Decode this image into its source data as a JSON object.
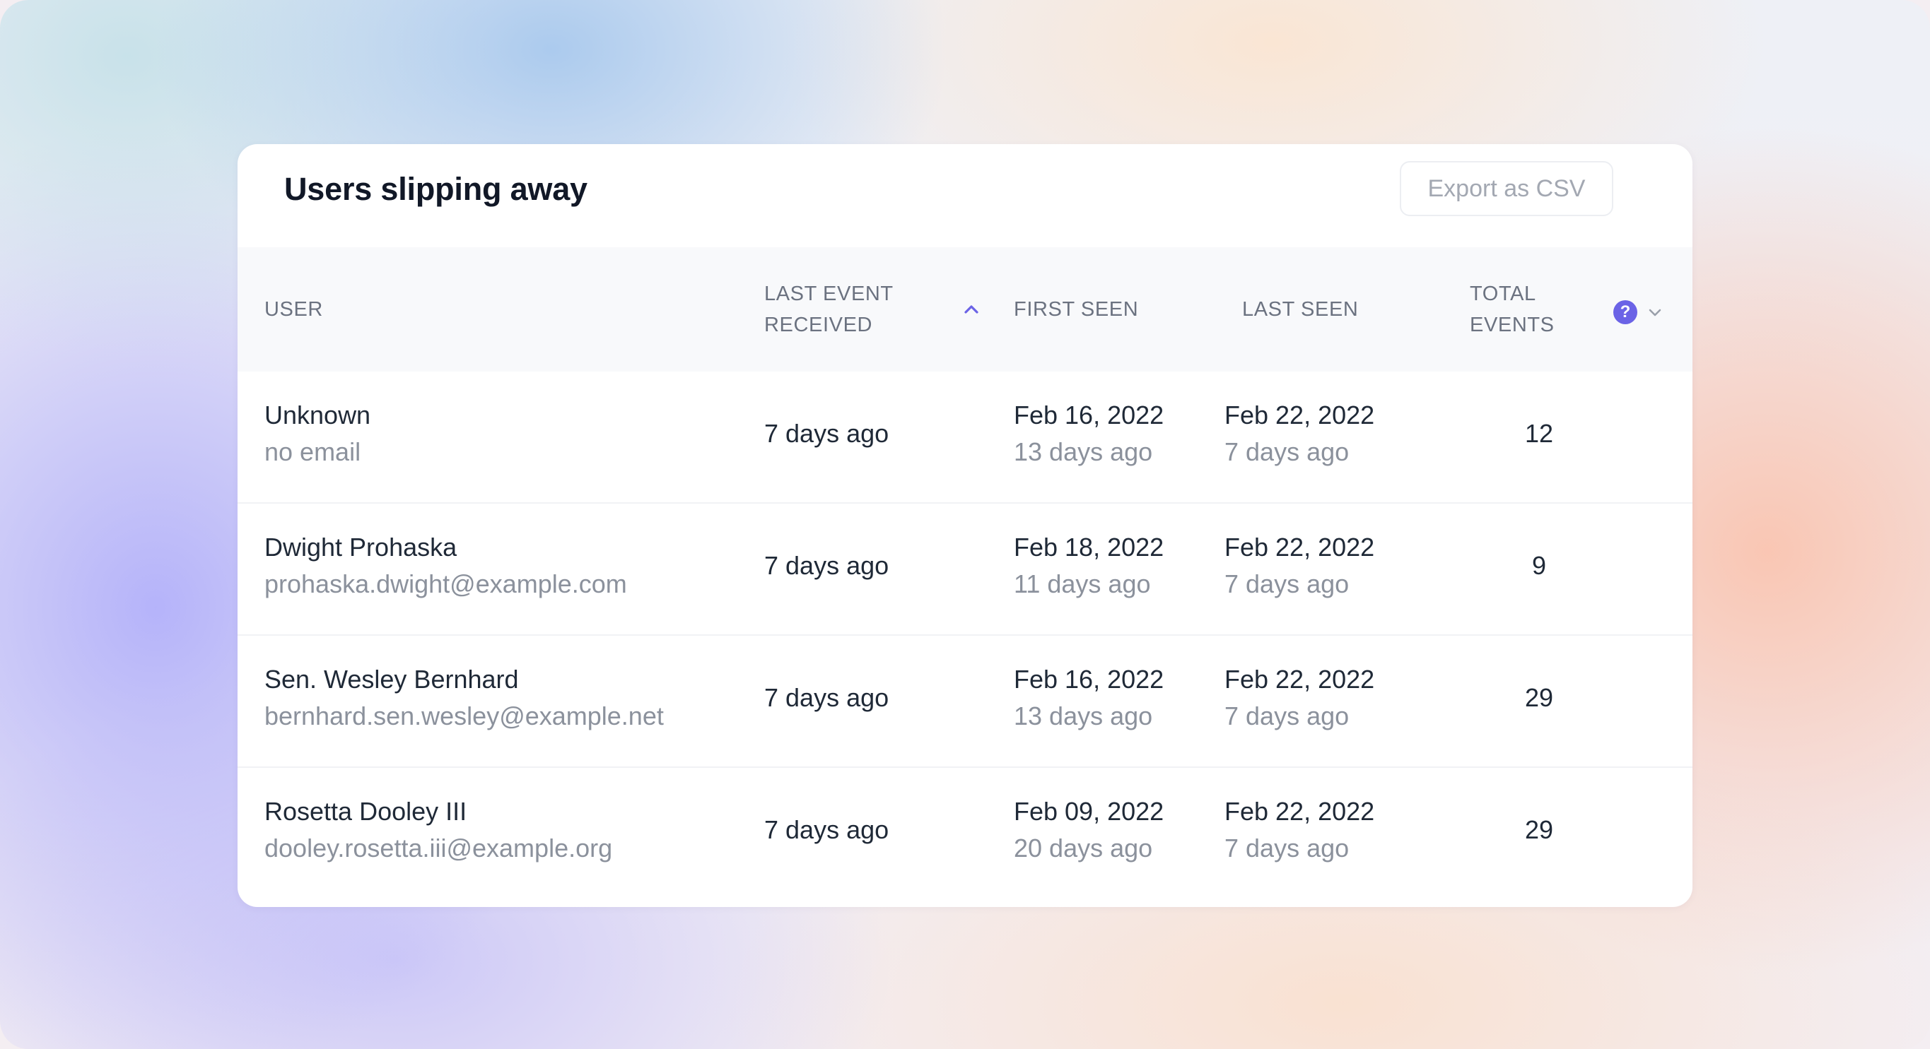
{
  "card": {
    "title": "Users slipping away",
    "export_label": "Export as CSV"
  },
  "columns": {
    "user": "USER",
    "last_event": "LAST EVENT RECEIVED",
    "first_seen": "FIRST SEEN",
    "last_seen": "LAST SEEN",
    "total_events": "TOTAL EVENTS"
  },
  "icons": {
    "sort": "chevron-up-icon",
    "help": "question-circle-icon",
    "menu": "chevron-down-icon",
    "help_glyph": "?",
    "accent_color": "#6b63e6"
  },
  "rows": [
    {
      "name": "Unknown",
      "email": "no email",
      "last_event": "7 days ago",
      "first_seen_date": "Feb 16, 2022",
      "first_seen_rel": "13 days ago",
      "last_seen_date": "Feb 22, 2022",
      "last_seen_rel": "7 days ago",
      "total": "12"
    },
    {
      "name": "Dwight Prohaska",
      "email": "prohaska.dwight@example.com",
      "last_event": "7 days ago",
      "first_seen_date": "Feb 18, 2022",
      "first_seen_rel": "11 days ago",
      "last_seen_date": "Feb 22, 2022",
      "last_seen_rel": "7 days ago",
      "total": "9"
    },
    {
      "name": "Sen. Wesley Bernhard",
      "email": "bernhard.sen.wesley@example.net",
      "last_event": "7 days ago",
      "first_seen_date": "Feb 16, 2022",
      "first_seen_rel": "13 days ago",
      "last_seen_date": "Feb 22, 2022",
      "last_seen_rel": "7 days ago",
      "total": "29"
    },
    {
      "name": "Rosetta Dooley III",
      "email": "dooley.rosetta.iii@example.org",
      "last_event": "7 days ago",
      "first_seen_date": "Feb 09, 2022",
      "first_seen_rel": "20 days ago",
      "last_seen_date": "Feb 22, 2022",
      "last_seen_rel": "7 days ago",
      "total": "29"
    }
  ]
}
